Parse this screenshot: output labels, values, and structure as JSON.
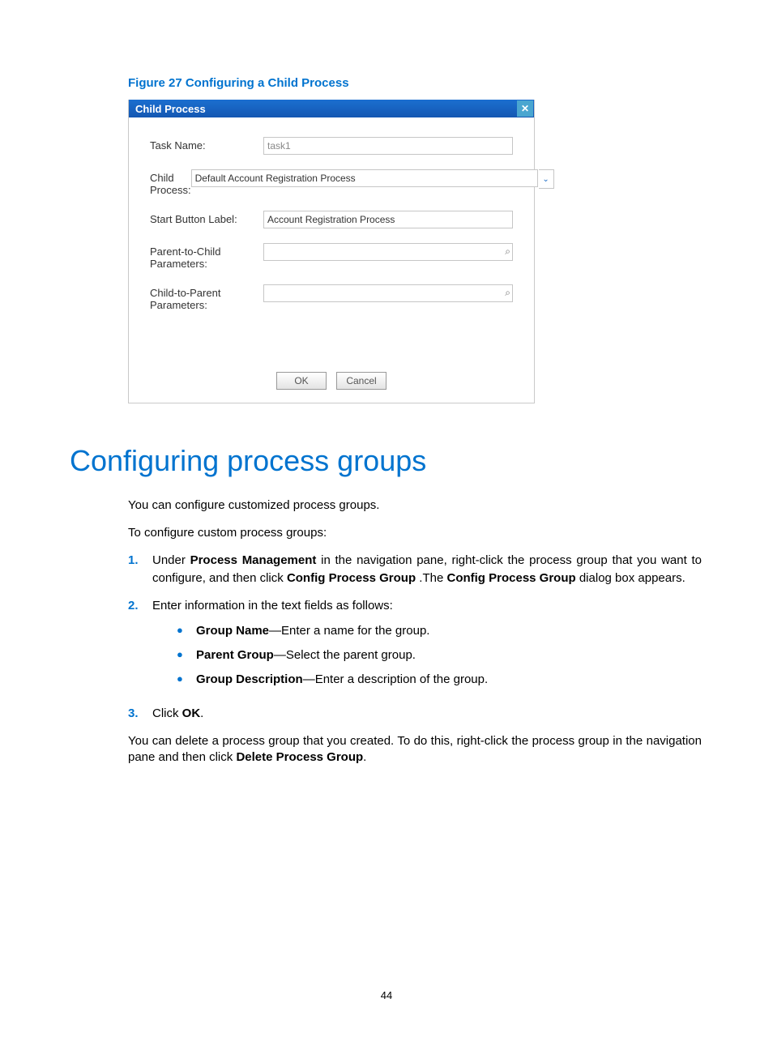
{
  "figure_caption": "Figure 27 Configuring a Child Process",
  "dialog": {
    "title": "Child Process",
    "labels": {
      "task_name": "Task Name:",
      "child_process": "Child Process:",
      "start_button_label": "Start Button Label:",
      "p2c": "Parent-to-Child Parameters:",
      "c2p": "Child-to-Parent Parameters:"
    },
    "values": {
      "task_name": "task1",
      "child_process": "Default Account Registration Process",
      "start_button_label": "Account Registration Process",
      "p2c": "",
      "c2p": ""
    },
    "buttons": {
      "ok": "OK",
      "cancel": "Cancel"
    }
  },
  "heading": "Configuring process groups",
  "p1": "You can configure customized process groups.",
  "p2": "To configure custom process groups:",
  "steps": {
    "s1a": "Under ",
    "s1b": "Process Management",
    "s1c": " in the navigation pane, right-click the process group that you want to configure, and then click ",
    "s1d": "Config Process Group",
    "s1e": " .The ",
    "s1f": "Config Process Group",
    "s1g": " dialog box appears.",
    "s2": "Enter information in the text fields as follows:",
    "b1a": "Group Name",
    "b1b": "—Enter a name for the group.",
    "b2a": "Parent Group",
    "b2b": "—Select the parent group.",
    "b3a": "Group Description",
    "b3b": "—Enter a description of the group.",
    "s3a": "Click ",
    "s3b": "OK",
    "s3c": "."
  },
  "p3a": "You can delete a process group that you created. To do this, right-click the process group in the navigation pane and then click ",
  "p3b": "Delete Process Group",
  "p3c": ".",
  "page_number": "44"
}
